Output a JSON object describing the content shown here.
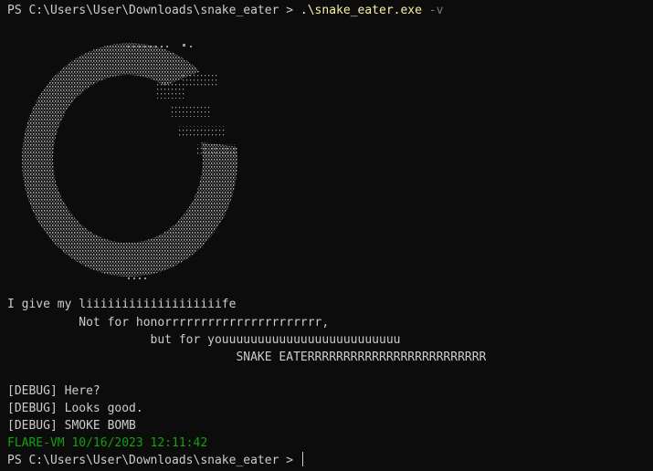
{
  "prompt1": {
    "ps": "PS C:\\Users\\User\\Downloads\\snake_eater > ",
    "command": ".\\snake_eater.exe",
    "flag": " -v"
  },
  "lyrics": [
    "I give my liiiiiiiiiiiiiiiiiiife",
    "          Not for honorrrrrrrrrrrrrrrrrrrrrr,",
    "                    but for youuuuuuuuuuuuuuuuuuuuuuuuu",
    "                                SNAKE EATERRRRRRRRRRRRRRRRRRRRRRRRR"
  ],
  "debug": [
    "[DEBUG] Here?",
    "[DEBUG] Looks good.",
    "[DEBUG] SMOKE BOMB"
  ],
  "flare_stamp": "FLARE-VM 10/16/2023 12:11:42",
  "prompt2": "PS C:\\Users\\User\\Downloads\\snake_eater > ",
  "colors": {
    "background": "#0c0c0c",
    "text": "#cccccc",
    "command": "#f9f1a5",
    "flag": "#767676",
    "flare": "#13a10e"
  }
}
